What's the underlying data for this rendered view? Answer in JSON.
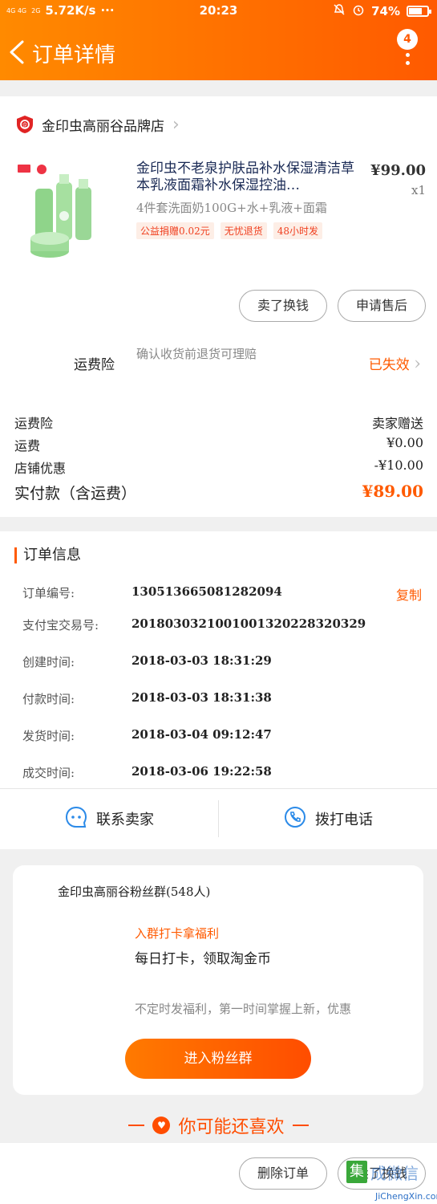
{
  "status_bar": {
    "network": "4G 4G",
    "signal_extra": "2G",
    "speed": "5.72K/s",
    "dots": "···",
    "time": "20:23",
    "battery": "74%",
    "battery_level": 0.74
  },
  "nav": {
    "title": "订单详情",
    "badge": "4"
  },
  "shop": {
    "name": "金印虫高丽谷品牌店"
  },
  "product": {
    "title": "金印虫不老泉护肤品补水保湿清洁草本乳液面霜补水保湿控油…",
    "price": "¥99.00",
    "qty": "x1",
    "sku": "4件套洗面奶100G+水+乳液+面霜",
    "tags": [
      "公益捐赠0.02元",
      "无忧退货",
      "48小时发"
    ]
  },
  "actions": {
    "refund": "卖了换钱",
    "after_sale": "申请售后"
  },
  "insurance": {
    "label": "运费险",
    "desc": "确认收货前退货可理赔",
    "status": "已失效"
  },
  "fees": [
    {
      "label": "运费险",
      "value": "卖家赠送"
    },
    {
      "label": "运费",
      "value": "¥0.00"
    },
    {
      "label": "店铺优惠",
      "value": "-¥10.00"
    }
  ],
  "total": {
    "label": "实付款（含运费）",
    "value": "¥89.00"
  },
  "order_info": {
    "heading": "订单信息",
    "copy_label": "复制",
    "rows": [
      {
        "label": "订单编号:",
        "value": "130513665081282094"
      },
      {
        "label": "支付宝交易号:",
        "value": "2018030321001001320228320329"
      },
      {
        "label": "创建时间:",
        "value": "2018-03-03  18:31:29"
      },
      {
        "label": "付款时间:",
        "value": "2018-03-03  18:31:38"
      },
      {
        "label": "发货时间:",
        "value": "2018-03-04  09:12:47"
      },
      {
        "label": "成交时间:",
        "value": "2018-03-06  19:22:58"
      }
    ]
  },
  "contact": {
    "seller": "联系卖家",
    "call": "拨打电话"
  },
  "fan_group": {
    "name": "金印虫高丽谷粉丝群(548人)",
    "promo": "入群打卡拿福利",
    "checkin": "每日打卡，领取淘金币",
    "desc": "不定时发福利，第一时间掌握上新，优惠",
    "join": "进入粉丝群"
  },
  "recommend": {
    "title": "你可能还喜欢"
  },
  "bottom": {
    "delete": "删除订单",
    "sell": "卖了换钱"
  },
  "watermark": {
    "box": "集",
    "text": "成微信",
    "sub": "JiChengXin.com"
  },
  "colors": {
    "accent": "#ff5a00",
    "header_start": "#ff8a00",
    "header_end": "#ff5a00"
  }
}
